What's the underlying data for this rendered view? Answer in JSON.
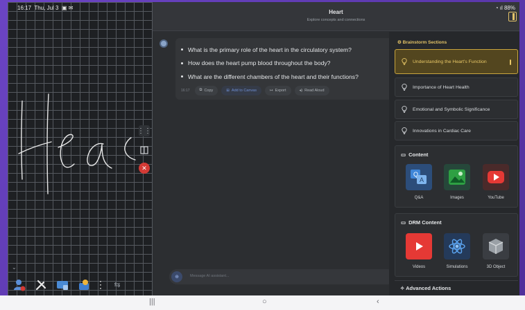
{
  "status_bar": {
    "time": "16:17",
    "date": "Thu, Jul 3",
    "battery": "88%"
  },
  "header": {
    "title": "Heart",
    "subtitle": "Explore concepts and connections"
  },
  "chat": {
    "questions": [
      "What is the primary role of the heart in the circulatory system?",
      "How does the heart pump blood throughout the body?",
      "What are the different chambers of the heart and their functions?"
    ],
    "time": "16:17",
    "actions": {
      "copy": "Copy",
      "add_to_canvas": "Add to Canvas",
      "export": "Export",
      "read_aloud": "Read Aloud"
    },
    "composer_placeholder": "Message AI assistant..."
  },
  "panel": {
    "title": "Brainstorm Sections",
    "sections": [
      "Understanding the Heart's Function",
      "Importance of Heart Health",
      "Emotional and Symbolic Significance",
      "Innovations in Cardiac Care"
    ],
    "content": {
      "title": "Content",
      "items": [
        "Q&A",
        "Images",
        "YouTube"
      ]
    },
    "drm_content": {
      "title": "DRM Content",
      "items": [
        "Videos",
        "Simulations",
        "3D Object"
      ]
    },
    "advanced_actions": "Advanced Actions"
  },
  "colors": {
    "accent": "#e2c266",
    "danger": "#d33a35",
    "frame": "#5a3aa5"
  }
}
